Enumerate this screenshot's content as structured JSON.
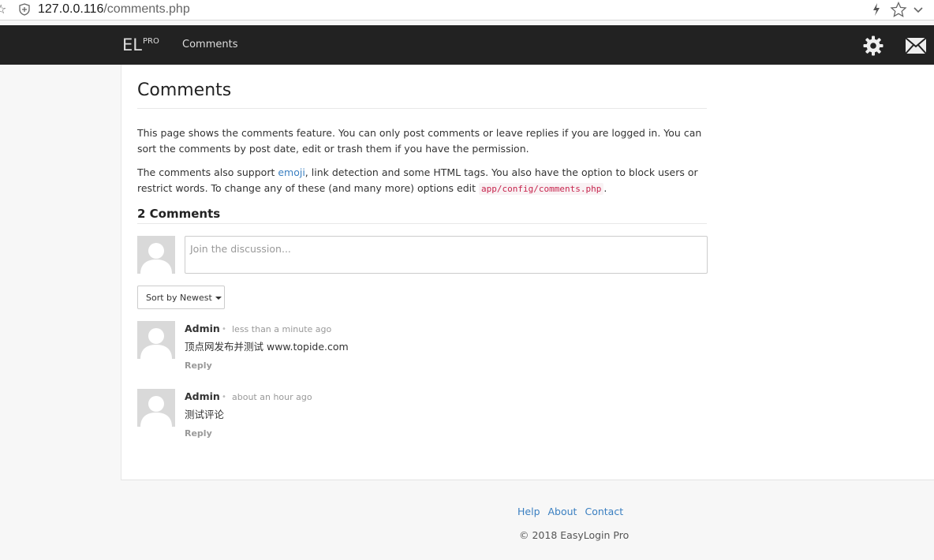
{
  "browser": {
    "url_host": "127.0.0.116",
    "url_path": "/comments.php",
    "icons": [
      "bookmark-star-icon",
      "shield-icon",
      "lightning-icon",
      "star-icon",
      "chevron-down-icon"
    ]
  },
  "navbar": {
    "brand": "EL",
    "brand_sup": "PRO",
    "link_comments": "Comments",
    "icons": [
      "gear-icon",
      "mail-icon"
    ]
  },
  "page": {
    "title": "Comments",
    "para1": "This page shows the comments feature. You can only post comments or leave replies if you are logged in. You can sort the comments by post date, edit or trash them if you have the permission.",
    "para2_a": "The comments also support ",
    "para2_link": "emoji",
    "para2_b": ", link detection and some HTML tags. You also have the option to block users or restrict words. To change any of these (and many more) options edit ",
    "para2_code": "app/config/comments.php",
    "para2_c": "."
  },
  "comments_section": {
    "count_title": "2 Comments",
    "input_placeholder": "Join the discussion...",
    "sort_label": "Sort by Newest",
    "separator": "•",
    "reply_label": "Reply",
    "items": [
      {
        "author": "Admin",
        "time": "less than a minute ago",
        "text": "顶点网发布并测试 www.topide.com"
      },
      {
        "author": "Admin",
        "time": "about an hour ago",
        "text": "测试评论"
      }
    ]
  },
  "footer": {
    "help": "Help",
    "about": "About",
    "contact": "Contact",
    "copyright": "© 2018 EasyLogin Pro"
  },
  "colors": {
    "navbar_bg": "#222222",
    "link": "#3a7fc1",
    "code_text": "#c7254e",
    "page_bg": "#f7f7f7"
  }
}
